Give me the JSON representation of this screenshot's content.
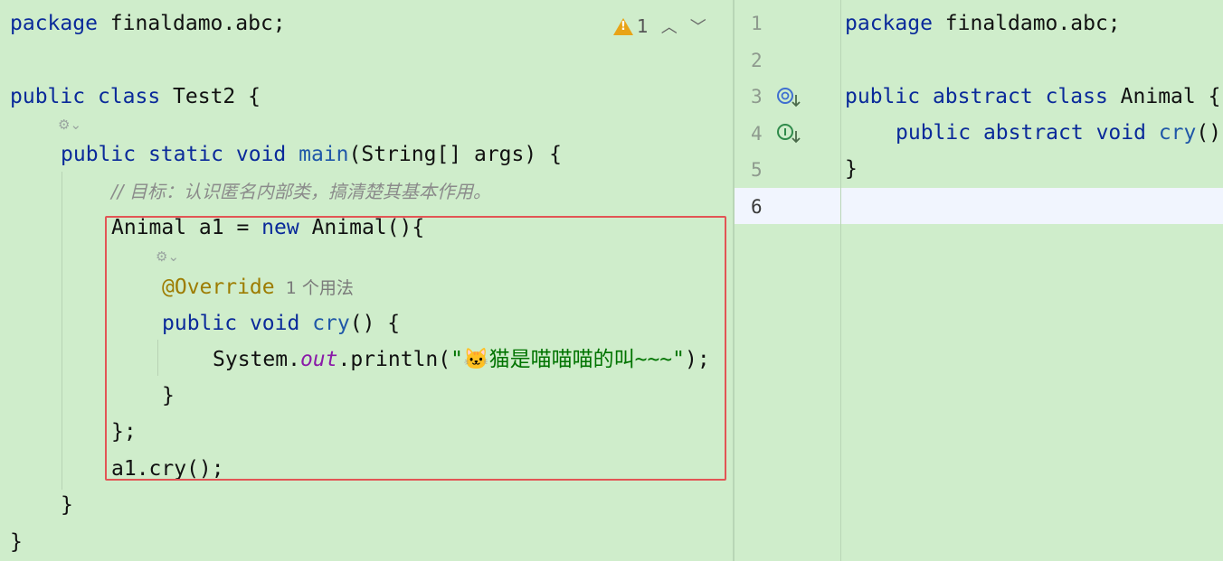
{
  "left_editor": {
    "warning_count": "1",
    "lines": [
      {
        "parts": [
          {
            "t": "package ",
            "c": "kw"
          },
          {
            "t": "finaldamo.abc;",
            "c": ""
          }
        ]
      },
      {
        "parts": [
          {
            "t": "public ",
            "c": "kw"
          },
          {
            "t": "class ",
            "c": "kw"
          },
          {
            "t": "Test2 {",
            "c": ""
          }
        ]
      },
      {
        "parts": [
          {
            "t": "public ",
            "c": "kw"
          },
          {
            "t": "static ",
            "c": "kw"
          },
          {
            "t": "void ",
            "c": "kw"
          },
          {
            "t": "main",
            "c": "fn"
          },
          {
            "t": "(String[] args) {",
            "c": ""
          }
        ]
      },
      {
        "parts": [
          {
            "t": "// 目标：认识匿名内部类，搞清楚其基本作用。",
            "c": "cm"
          }
        ]
      },
      {
        "parts": [
          {
            "t": "Animal a1 = ",
            "c": ""
          },
          {
            "t": "new ",
            "c": "kw"
          },
          {
            "t": "Animal(){",
            "c": ""
          }
        ]
      },
      {
        "parts": [
          {
            "t": "@Override",
            "c": "an"
          },
          {
            "t": "  1 个用法",
            "c": "hint"
          }
        ]
      },
      {
        "parts": [
          {
            "t": "public ",
            "c": "kw"
          },
          {
            "t": "void ",
            "c": "kw"
          },
          {
            "t": "cry",
            "c": "fn"
          },
          {
            "t": "() {",
            "c": ""
          }
        ]
      },
      {
        "parts": [
          {
            "t": "System.",
            "c": ""
          },
          {
            "t": "out",
            "c": "field"
          },
          {
            "t": ".println(",
            "c": ""
          },
          {
            "t": "\"🐱猫是喵喵喵的叫~~~\"",
            "c": "st"
          },
          {
            "t": ");",
            "c": ""
          }
        ]
      },
      {
        "parts": [
          {
            "t": "}",
            "c": ""
          }
        ]
      },
      {
        "parts": [
          {
            "t": "};",
            "c": ""
          }
        ]
      },
      {
        "parts": [
          {
            "t": "a1.cry();",
            "c": ""
          }
        ]
      },
      {
        "parts": [
          {
            "t": "}",
            "c": ""
          }
        ]
      },
      {
        "parts": [
          {
            "t": "}",
            "c": ""
          }
        ]
      }
    ]
  },
  "right_editor": {
    "line_numbers": [
      "1",
      "2",
      "3",
      "4",
      "5",
      "6"
    ],
    "lines": [
      {
        "parts": [
          {
            "t": "package ",
            "c": "kw"
          },
          {
            "t": "finaldamo.abc;",
            "c": ""
          }
        ]
      },
      {
        "parts": [
          {
            "t": "public ",
            "c": "kw"
          },
          {
            "t": "abstract ",
            "c": "kw"
          },
          {
            "t": "class ",
            "c": "kw"
          },
          {
            "t": "Animal {",
            "c": ""
          }
        ]
      },
      {
        "parts": [
          {
            "t": "public ",
            "c": "kw"
          },
          {
            "t": "abstract ",
            "c": "kw"
          },
          {
            "t": "void ",
            "c": "kw"
          },
          {
            "t": "cry",
            "c": "fn"
          },
          {
            "t": "();",
            "c": ""
          }
        ]
      },
      {
        "parts": [
          {
            "t": "}",
            "c": ""
          }
        ]
      }
    ]
  },
  "icons": {
    "warning": "warning-triangle-icon",
    "up": "chevron-up-icon",
    "down": "chevron-down-icon",
    "implemented": "implemented-icon",
    "implementing": "implementing-icon",
    "inlay": "inlay-settings-icon"
  }
}
